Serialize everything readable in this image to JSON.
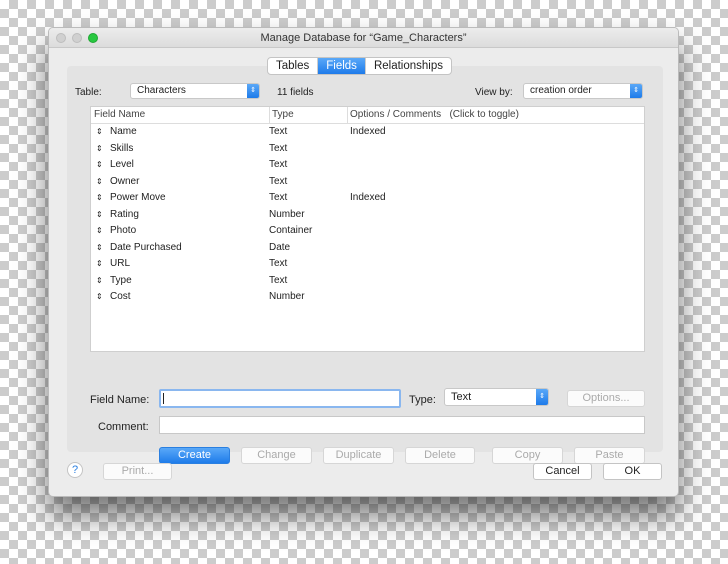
{
  "window": {
    "title": "Manage Database for “Game_Characters”"
  },
  "tabs": [
    {
      "label": "Tables"
    },
    {
      "label": "Fields",
      "active": true
    },
    {
      "label": "Relationships"
    }
  ],
  "table_label": "Table:",
  "table_value": "Characters",
  "field_count": "11 fields",
  "viewby_label": "View by:",
  "viewby_value": "creation order",
  "columns": [
    "Field Name",
    "Type",
    "Options / Comments   (Click to toggle)"
  ],
  "fields": [
    {
      "name": "Name",
      "type": "Text",
      "options": "Indexed"
    },
    {
      "name": "Skills",
      "type": "Text",
      "options": ""
    },
    {
      "name": "Level",
      "type": "Text",
      "options": ""
    },
    {
      "name": "Owner",
      "type": "Text",
      "options": ""
    },
    {
      "name": "Power Move",
      "type": "Text",
      "options": "Indexed"
    },
    {
      "name": "Rating",
      "type": "Number",
      "options": ""
    },
    {
      "name": "Photo",
      "type": "Container",
      "options": ""
    },
    {
      "name": "Date Purchased",
      "type": "Date",
      "options": ""
    },
    {
      "name": "URL",
      "type": "Text",
      "options": ""
    },
    {
      "name": "Type",
      "type": "Text",
      "options": ""
    },
    {
      "name": "Cost",
      "type": "Number",
      "options": ""
    }
  ],
  "form": {
    "field_name_label": "Field Name:",
    "field_name_value": "",
    "type_label": "Type:",
    "type_value": "Text",
    "options_button": "Options...",
    "comment_label": "Comment:",
    "comment_value": ""
  },
  "actions": {
    "create": "Create",
    "change": "Change",
    "duplicate": "Duplicate",
    "delete": "Delete",
    "copy": "Copy",
    "paste": "Paste"
  },
  "footer": {
    "help": "?",
    "print": "Print...",
    "cancel": "Cancel",
    "ok": "OK"
  },
  "colors": {
    "accent": "#1e7bea",
    "close": "#d0d0d0",
    "zoom": "#28c840"
  }
}
